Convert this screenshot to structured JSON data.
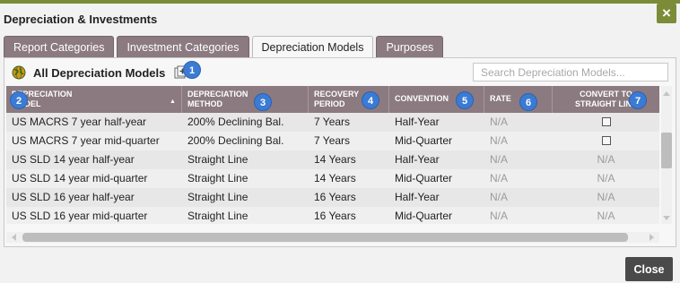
{
  "window": {
    "title": "Depreciation & Investments",
    "close_label": "×"
  },
  "tabs": [
    {
      "label": "Report Categories",
      "active": false
    },
    {
      "label": "Investment Categories",
      "active": false
    },
    {
      "label": "Depreciation Models",
      "active": true
    },
    {
      "label": "Purposes",
      "active": false
    }
  ],
  "panel": {
    "title": "All Depreciation Models",
    "title_icon": "globe-icon",
    "add_icon": "add-icon",
    "search_placeholder": "Search Depreciation Models..."
  },
  "table": {
    "headers": [
      {
        "line1": "Depreciation",
        "line2": "Model",
        "badge": "2",
        "sort_icon": "▲"
      },
      {
        "line1": "Depreciation",
        "line2": "Method",
        "badge": "3"
      },
      {
        "line1": "Recovery",
        "line2": "Period",
        "badge": "4"
      },
      {
        "line1": "Convention",
        "line2": "",
        "badge": "5"
      },
      {
        "line1": "Rate",
        "line2": "",
        "badge": "6"
      },
      {
        "line1": "Convert to",
        "line2": "Straight Line",
        "badge": "7"
      }
    ],
    "rows": [
      {
        "model": "US MACRS 7 year half-year",
        "method": "200% Declining Bal.",
        "period": "7 Years",
        "convention": "Half-Year",
        "rate": "N/A",
        "convert": "checkbox"
      },
      {
        "model": "US MACRS 7 year mid-quarter",
        "method": "200% Declining Bal.",
        "period": "7 Years",
        "convention": "Mid-Quarter",
        "rate": "N/A",
        "convert": "checkbox"
      },
      {
        "model": "US SLD 14 year half-year",
        "method": "Straight Line",
        "period": "14 Years",
        "convention": "Half-Year",
        "rate": "N/A",
        "convert": "N/A"
      },
      {
        "model": "US SLD 14 year mid-quarter",
        "method": "Straight Line",
        "period": "14 Years",
        "convention": "Mid-Quarter",
        "rate": "N/A",
        "convert": "N/A"
      },
      {
        "model": "US SLD 16 year half-year",
        "method": "Straight Line",
        "period": "16 Years",
        "convention": "Half-Year",
        "rate": "N/A",
        "convert": "N/A"
      },
      {
        "model": "US SLD 16 year mid-quarter",
        "method": "Straight Line",
        "period": "16 Years",
        "convention": "Mid-Quarter",
        "rate": "N/A",
        "convert": "N/A"
      }
    ]
  },
  "badges": {
    "add": "1"
  },
  "footer": {
    "close_label": "Close"
  },
  "colors": {
    "accent": "#7a8c38",
    "tab": "#8b7a80",
    "badge": "#3b7bd4"
  }
}
